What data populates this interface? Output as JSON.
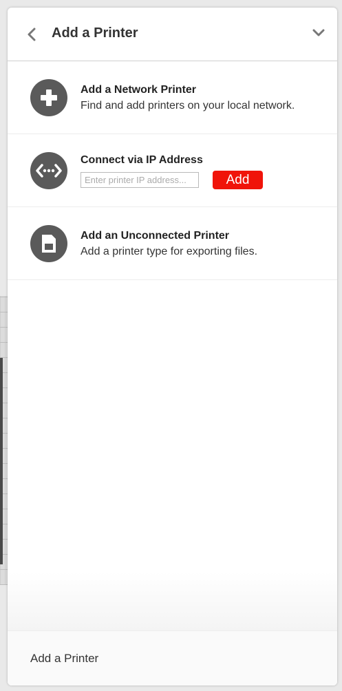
{
  "header": {
    "title": "Add a Printer",
    "back_icon": "chevron-left-icon",
    "collapse_icon": "chevron-down-icon"
  },
  "options": [
    {
      "icon": "plus-icon",
      "title": "Add a Network Printer",
      "subtitle": "Find and add printers on your local network."
    },
    {
      "icon": "network-ip-icon",
      "title": "Connect via IP Address",
      "input_placeholder": "Enter printer IP address...",
      "input_value": "",
      "button_label": "Add",
      "button_color": "#f0140a"
    },
    {
      "icon": "sd-card-icon",
      "title": "Add an Unconnected Printer",
      "subtitle": "Add a printer type for exporting files."
    }
  ],
  "footer": {
    "label": "Add a Printer"
  }
}
